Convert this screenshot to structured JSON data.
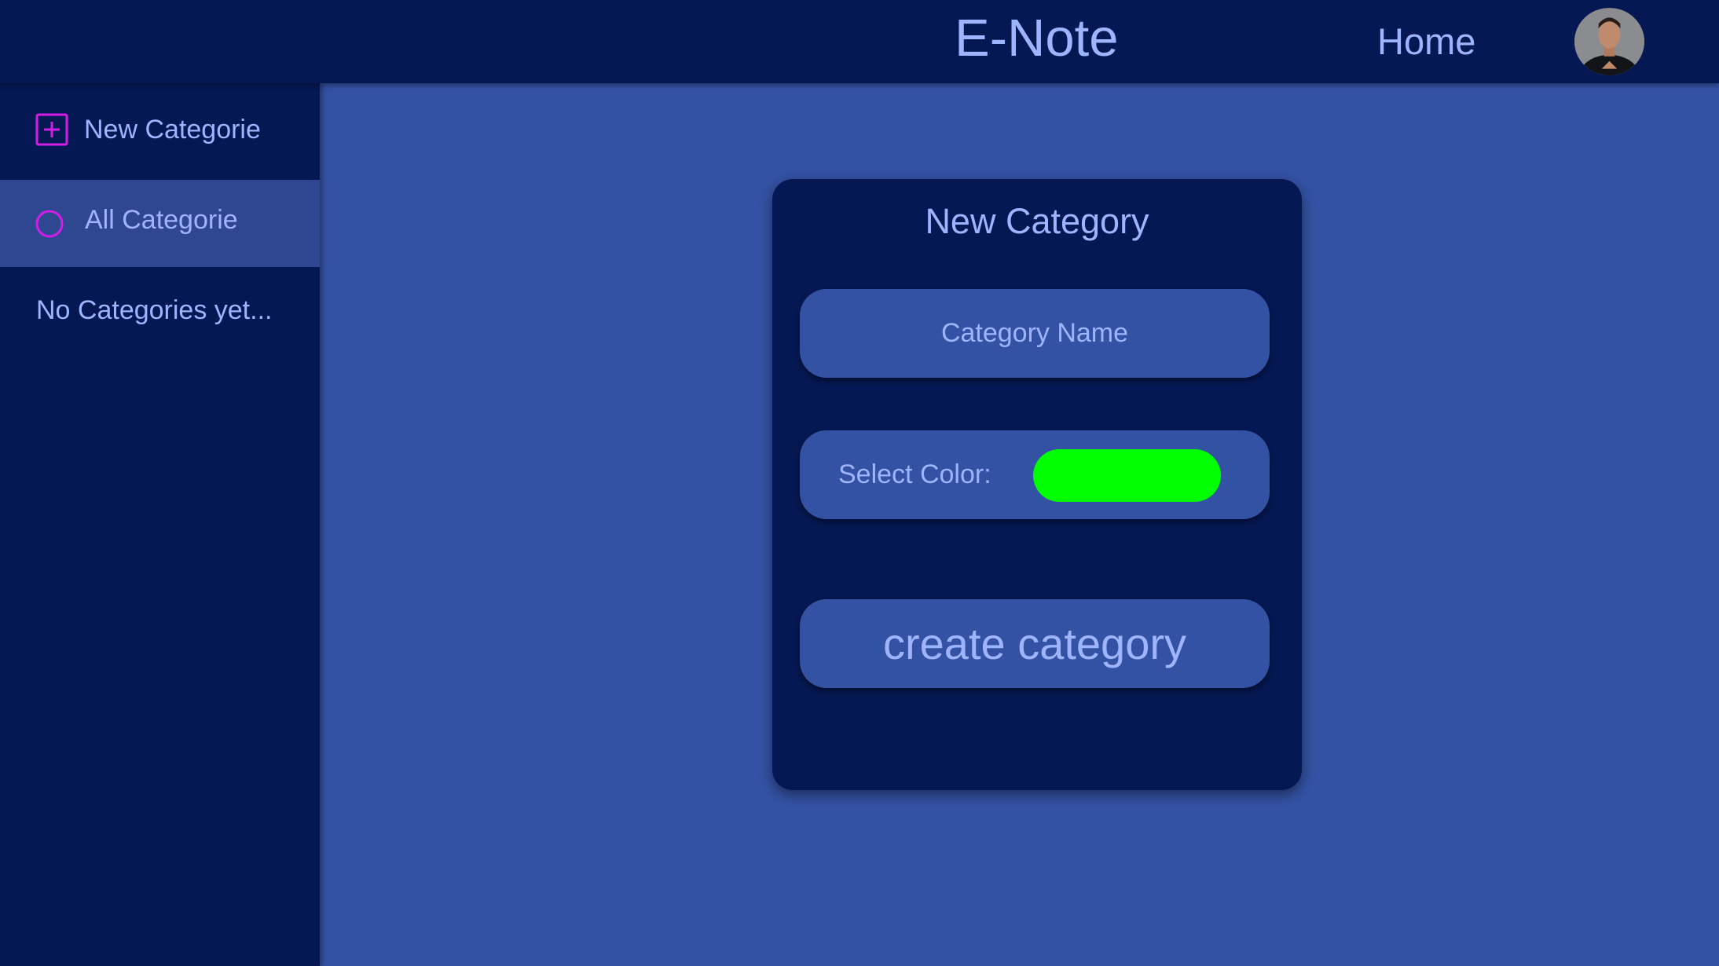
{
  "header": {
    "app_title": "E-Note",
    "home_label": "Home"
  },
  "sidebar": {
    "items": [
      {
        "label": "New Categorie",
        "icon": "plus-square-icon"
      },
      {
        "label": "All Categorie",
        "icon": "circle-icon",
        "active": true
      }
    ],
    "empty_text": "No Categories yet..."
  },
  "form": {
    "title": "New Category",
    "name_placeholder": "Category Name",
    "name_value": "",
    "color_label": "Select Color:",
    "color_value": "#00ff00",
    "submit_label": "create category"
  },
  "colors": {
    "header_bg": "#051853",
    "page_bg": "#3452a3",
    "text": "#9fb4ff",
    "icon_accent": "#d21ee6"
  }
}
